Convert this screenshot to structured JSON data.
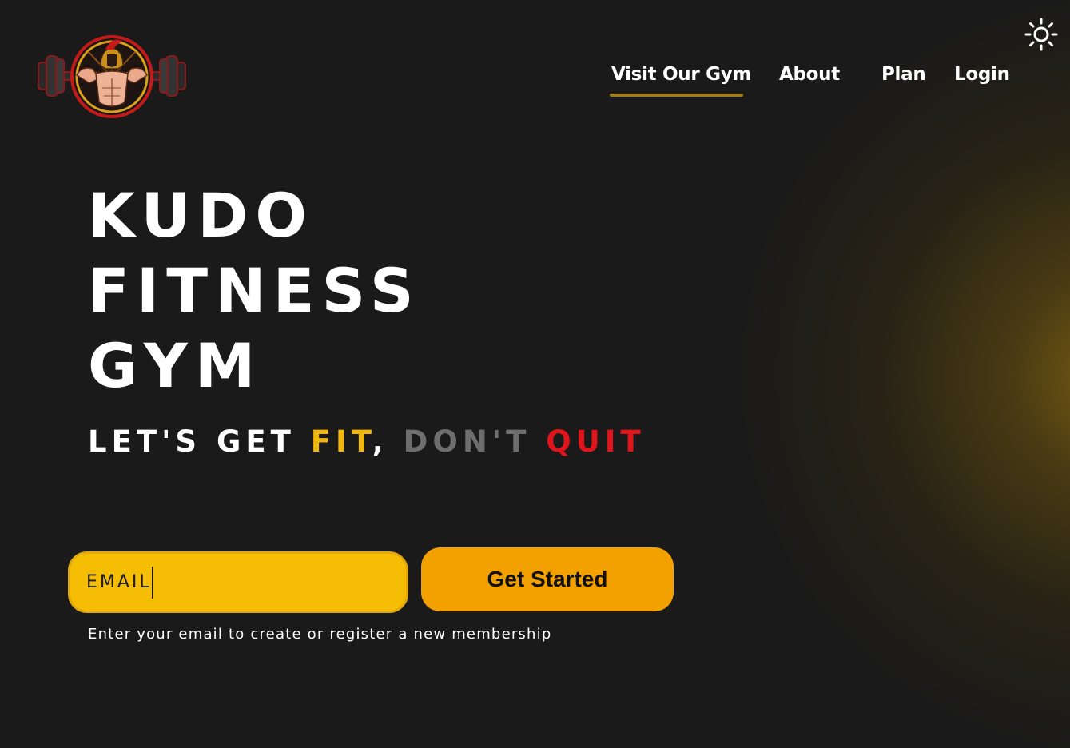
{
  "nav": {
    "items": [
      {
        "label": "Visit Our Gym",
        "active": true
      },
      {
        "label": "About",
        "active": false
      },
      {
        "label": "Plan",
        "active": false
      },
      {
        "label": "Login",
        "active": false
      }
    ]
  },
  "theme_toggle": {
    "icon": "sun-icon"
  },
  "logo": {
    "icon": "spartan-barbell-logo"
  },
  "hero": {
    "lines": [
      "KUDO",
      "FITNESS",
      "GYM"
    ],
    "slogan": {
      "part1": "LET'S GET ",
      "part2": "FIT",
      "part3": ", ",
      "part4": "DON'T ",
      "part5": "QUIT"
    }
  },
  "form": {
    "email_placeholder": "EMAIL",
    "email_value": "",
    "submit_label": "Get Started",
    "helper_text": "Enter your email to create or register a new membership"
  },
  "colors": {
    "background": "#1a1a1a",
    "accent_yellow": "#f5be04",
    "accent_orange": "#f2a100",
    "highlight_red": "#e0141b",
    "muted_grey": "#6e6e6e",
    "nav_underline": "#a37d12"
  }
}
